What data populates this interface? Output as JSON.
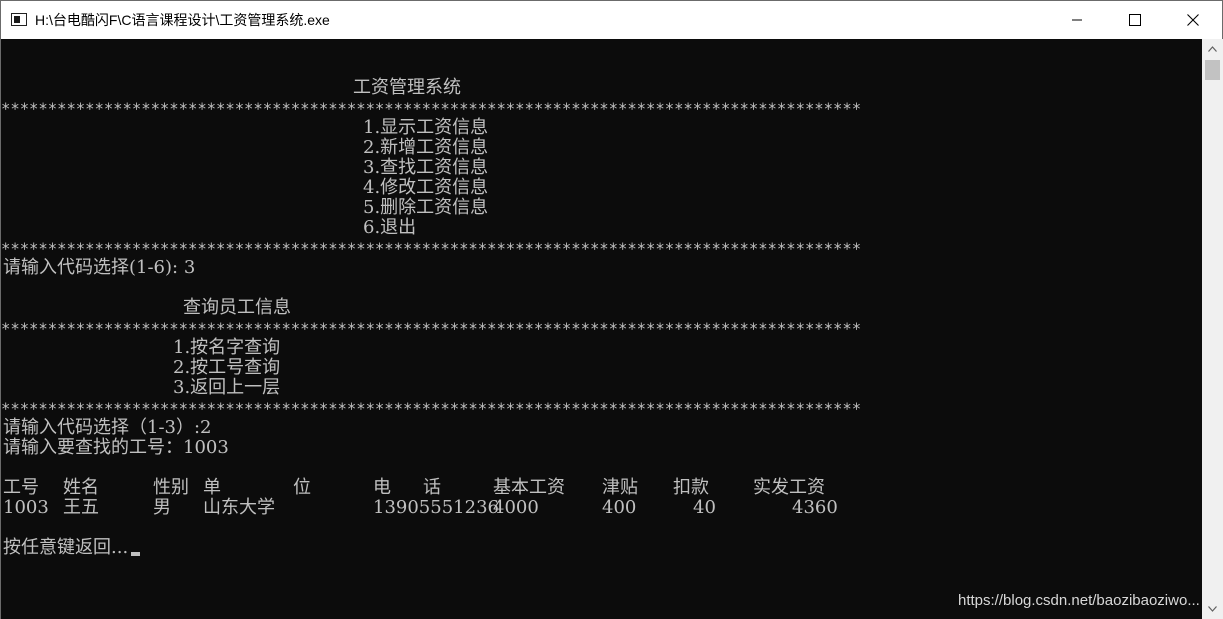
{
  "window": {
    "title": "H:\\台电酷闪F\\C语言课程设计\\工资管理系统.exe"
  },
  "console": {
    "main_title": "工资管理系统",
    "stars": "********************************************************************************************",
    "menu": [
      "1.显示工资信息",
      "2.新增工资信息",
      "3.查找工资信息",
      "4.修改工资信息",
      "5.删除工资信息",
      "6.退出"
    ],
    "prompt_main": "请输入代码选择(1-6): 3",
    "sub_title": "查询员工信息",
    "sub_menu": [
      "1.按名字查询",
      "2.按工号查询",
      "3.返回上一层"
    ],
    "prompt_sub": "请输入代码选择（1-3）:2",
    "prompt_id": "请输入要查找的工号：1003",
    "table": {
      "headers": [
        "工号",
        "姓名",
        "性别",
        "单",
        "位",
        "电",
        "话",
        "基本工资",
        "津贴",
        "扣款",
        "实发工资"
      ],
      "row": {
        "id": "1003",
        "name": "王五",
        "gender": "男",
        "unit": "山东大学",
        "phone": "13905551236",
        "base_salary": "4000",
        "allowance": "400",
        "deduction": "40",
        "net_salary": "4360"
      }
    },
    "prompt_return": "按任意键返回..."
  },
  "watermark": "https://blog.csdn.net/baozibaoziwo..."
}
